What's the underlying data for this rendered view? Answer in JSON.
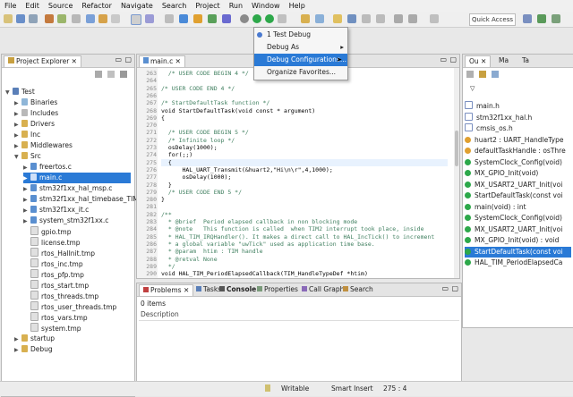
{
  "menubar": {
    "items": [
      "File",
      "Edit",
      "Source",
      "Refactor",
      "Navigate",
      "Search",
      "Project",
      "Run",
      "Window",
      "Help"
    ]
  },
  "toolbar": {
    "quick_access": "Quick Access"
  },
  "popup": {
    "items": [
      "1 Test Debug",
      "Debug As",
      "Debug Configurations...",
      "Organize Favorites..."
    ]
  },
  "explorer": {
    "tab": "Project Explorer",
    "rows": [
      "Test",
      "Binaries",
      "Includes",
      "Drivers",
      "Inc",
      "Middlewares",
      "Src",
      "freertos.c",
      "main.c",
      "stm32f1xx_hal_msp.c",
      "stm32f1xx_hal_timebase_TIM...",
      "stm32f1xx_it.c",
      "system_stm32f1xx.c",
      "gpio.tmp",
      "license.tmp",
      "rtos_HalInit.tmp",
      "rtos_inc.tmp",
      "rtos_pfp.tmp",
      "rtos_start.tmp",
      "rtos_threads.tmp",
      "rtos_user_threads.tmp",
      "rtos_vars.tmp",
      "system.tmp",
      "startup",
      "Debug"
    ]
  },
  "editor": {
    "tab": "main.c",
    "lines": [
      {
        "n": "263",
        "t": "  /* USER CODE BEGIN 4 */"
      },
      {
        "n": "264",
        "t": ""
      },
      {
        "n": "265",
        "t": "/* USER CODE END 4 */"
      },
      {
        "n": "266",
        "t": ""
      },
      {
        "n": "267",
        "t": "/* StartDefaultTask function */"
      },
      {
        "n": "268",
        "t": "void StartDefaultTask(void const * argument)"
      },
      {
        "n": "269",
        "t": "{"
      },
      {
        "n": "270",
        "t": ""
      },
      {
        "n": "271",
        "t": "  /* USER CODE BEGIN 5 */"
      },
      {
        "n": "272",
        "t": "  /* Infinite loop */"
      },
      {
        "n": "273",
        "t": "  osDelay(1000);"
      },
      {
        "n": "274",
        "t": "  for(;;)"
      },
      {
        "n": "275",
        "t": "  {"
      },
      {
        "n": "276",
        "t": "      HAL_UART_Transmit(&huart2,\"Hi\\n\\r\",4,1000);"
      },
      {
        "n": "277",
        "t": "      osDelay(1000);"
      },
      {
        "n": "278",
        "t": "  }"
      },
      {
        "n": "279",
        "t": "  /* USER CODE END 5 */"
      },
      {
        "n": "280",
        "t": "}"
      },
      {
        "n": "281",
        "t": ""
      },
      {
        "n": "282",
        "t": "/**"
      },
      {
        "n": "283",
        "t": "  * @brief  Period elapsed callback in non blocking mode"
      },
      {
        "n": "284",
        "t": "  * @note   This function is called  when TIM2 interrupt took place, inside"
      },
      {
        "n": "285",
        "t": "  * HAL_TIM_IRQHandler(). It makes a direct call to HAL_IncTick() to increment"
      },
      {
        "n": "286",
        "t": "  * a global variable \"uwTick\" used as application time base."
      },
      {
        "n": "287",
        "t": "  * @param  htim : TIM handle"
      },
      {
        "n": "288",
        "t": "  * @retval None"
      },
      {
        "n": "289",
        "t": "  */"
      },
      {
        "n": "290",
        "t": "void HAL_TIM_PeriodElapsedCallback(TIM_HandleTypeDef *htim)"
      }
    ]
  },
  "outline": {
    "tabs": [
      "Ou",
      "Ma",
      "Ta"
    ],
    "rows": [
      "main.h",
      "stm32f1xx_hal.h",
      "cmsis_os.h",
      "huart2 : UART_HandleType",
      "defaultTaskHandle : osThre",
      "SystemClock_Config(void)",
      "MX_GPIO_Init(void)",
      "MX_USART2_UART_Init(voi",
      "StartDefaultTask(const voi",
      "main(void) : int",
      "SystemClock_Config(void)",
      "MX_USART2_UART_Init(voi",
      "MX_GPIO_Init(void) : void",
      "StartDefaultTask(const voi",
      "HAL_TIM_PeriodElapsedCa"
    ]
  },
  "bottom": {
    "tabs": [
      "Problems",
      "Tasks",
      "Console",
      "Properties",
      "Call Graph",
      "Search"
    ],
    "items_count": "0 items",
    "column": "Description"
  },
  "status": {
    "mode": "Writable",
    "insert": "Smart Insert",
    "position": "275 : 4"
  }
}
